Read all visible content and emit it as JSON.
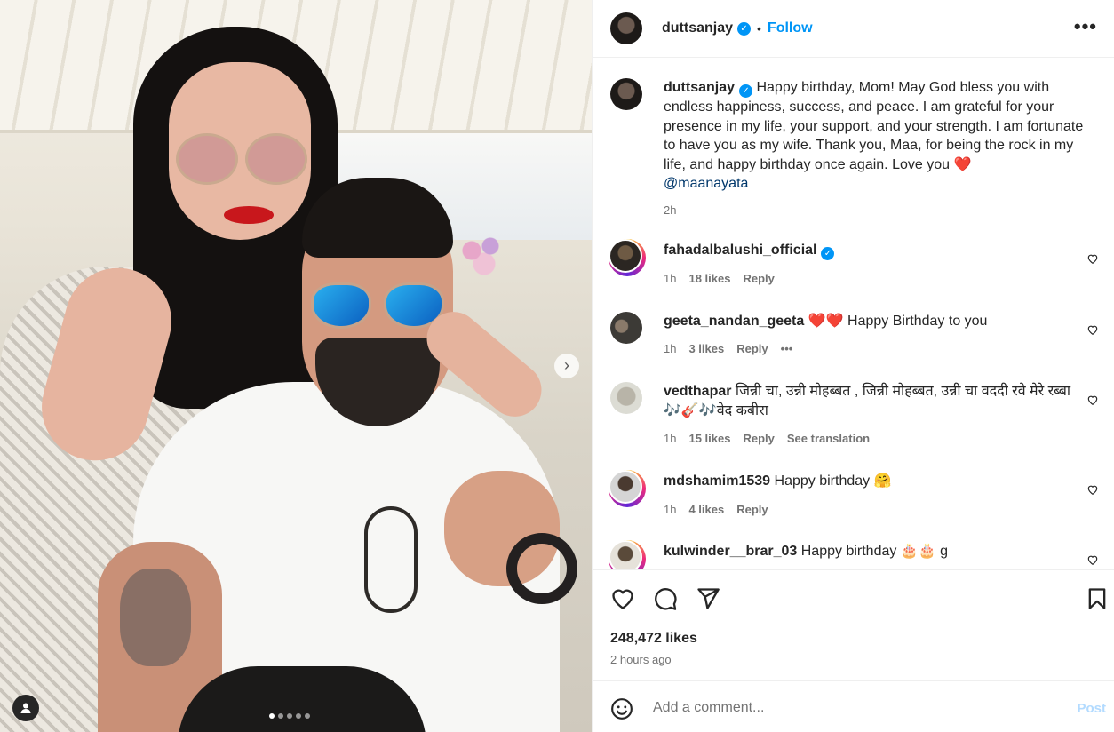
{
  "post_header": {
    "username": "duttsanjay",
    "separator": "•",
    "follow_label": "Follow",
    "more_label": "•••"
  },
  "caption": {
    "username": "duttsanjay",
    "text": "Happy birthday, Mom! May God bless you with endless happiness, success, and peace. I am grateful for your presence in my life, your support, and your strength. I am fortunate to have you as my wife. Thank you, Maa, for being the rock in my life, and happy birthday once again. Love you",
    "emoji": "❤️",
    "mention": "@maanayata",
    "time": "2h"
  },
  "comments": [
    {
      "username": "fahadalbalushi_official",
      "text": "",
      "time": "1h",
      "likes": "18 likes",
      "reply": "Reply"
    },
    {
      "username": "geeta_nandan_geeta",
      "emoji": "❤️❤️",
      "text": "Happy Birthday to you",
      "time": "1h",
      "likes": "3 likes",
      "reply": "Reply",
      "more": "•••"
    },
    {
      "username": "vedthapar",
      "text": "जिन्नी चा, उन्नी मोहब्बत , जिन्नी मोहब्बत, उन्नी चा वददी रवे मेरे रब्बा 🎶🎸🎶वेद कबीरा",
      "time": "1h",
      "likes": "15 likes",
      "reply": "Reply",
      "translate": "See translation"
    },
    {
      "username": "mdshamim1539",
      "text": "Happy birthday 🤗",
      "time": "1h",
      "likes": "4 likes",
      "reply": "Reply"
    },
    {
      "username": "kulwinder__brar_03",
      "text": "Happy birthday 🎂🎂 g"
    }
  ],
  "stats": {
    "likes": "248,472 likes",
    "posted": "2 hours ago"
  },
  "add_comment": {
    "placeholder": "Add a comment...",
    "post_label": "Post"
  },
  "carousel": {
    "total": 5,
    "active": 1,
    "next_label": "›"
  },
  "colors": {
    "link": "#0095f6",
    "verified": "#0095f6",
    "heart": "#e0242c",
    "muted": "#737373"
  },
  "icons": [
    "verified-icon",
    "more-icon",
    "heart-icon",
    "comment-icon",
    "share-icon",
    "save-icon",
    "emoji-icon",
    "tag-user-icon",
    "chevron-right-icon"
  ]
}
